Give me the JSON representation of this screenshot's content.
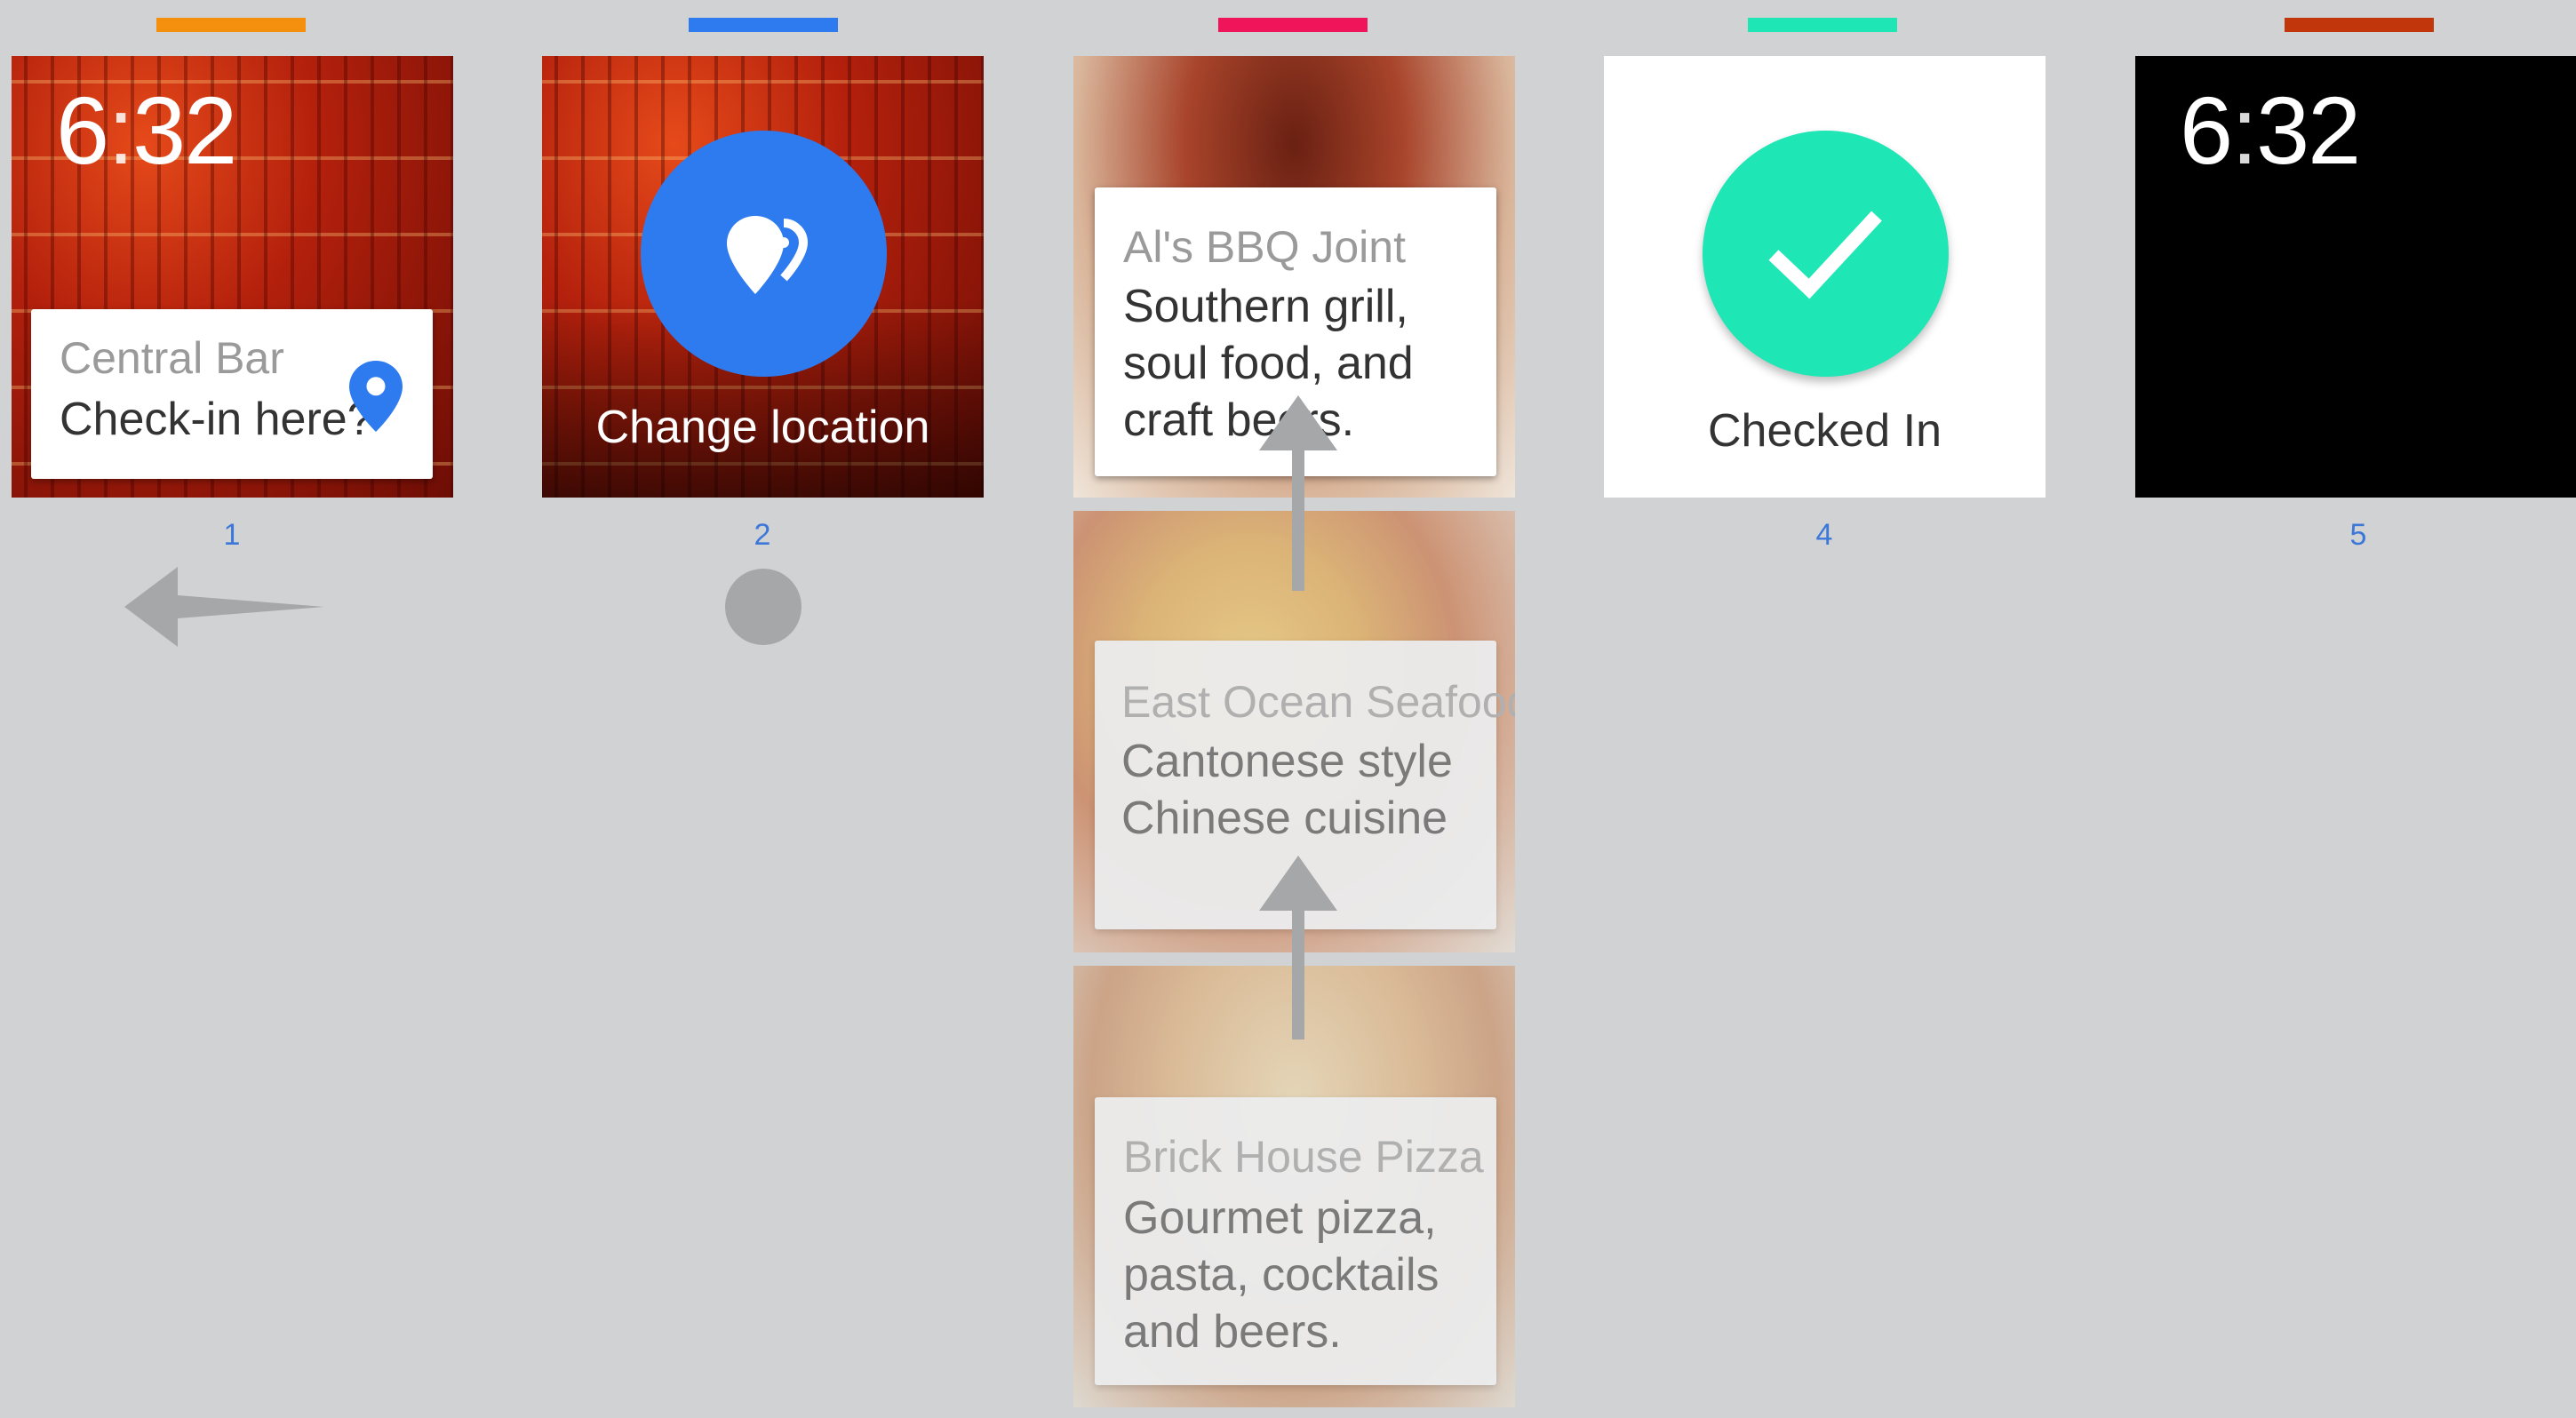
{
  "colors": {
    "background": "#d1d2d4",
    "bar_1": "#f5900f",
    "bar_2": "#2e7bf0",
    "bar_3": "#f0145a",
    "bar_4": "#1ee6b4",
    "bar_5": "#c2360c",
    "accent_blue": "#2e7bf0",
    "check_green": "#1ee6b4",
    "index_blue": "#3d78d8"
  },
  "screen1": {
    "time_hour": "6",
    "time_sep": ":",
    "time_min": "32",
    "card_title": "Central Bar",
    "card_body": "Check-in here?",
    "icon": "location-pin-icon",
    "index": "1",
    "gesture": "swipe-left-arrow"
  },
  "screen2": {
    "icon": "change-location-icon",
    "label": "Change location",
    "index": "2",
    "gesture": "tap-circle"
  },
  "screen3": {
    "restaurants": [
      {
        "name": "Al's BBQ Joint",
        "lines": [
          "Southern grill,",
          "soul food, and",
          "craft beers."
        ]
      },
      {
        "name": "East Ocean Seafood",
        "lines": [
          "Cantonese style",
          "Chinese cuisine"
        ]
      },
      {
        "name": "Brick House Pizza",
        "lines": [
          "Gourmet pizza,",
          "pasta, cocktails",
          "and beers."
        ]
      }
    ]
  },
  "screen4": {
    "icon": "checkmark-icon",
    "label": "Checked In",
    "index": "4"
  },
  "screen5": {
    "time_hour": "6",
    "time_sep": ":",
    "time_min": "32",
    "index": "5"
  }
}
